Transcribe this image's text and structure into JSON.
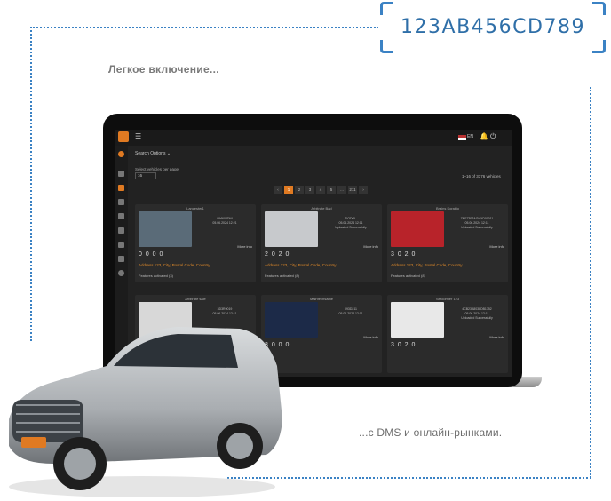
{
  "vin_code": "123AB456CD789",
  "caption_top": "Легкое включение...",
  "caption_bottom": "...с DMS и онлайн-рынками.",
  "colors": {
    "accent_blue": "#3b82c4",
    "accent_orange": "#e07a22"
  },
  "app": {
    "search_options": "Search Options ⌄",
    "select_label": "Select vehicles per page",
    "select_value": "16",
    "count_text": "1–16 of 3376 vehicles",
    "lang": "EN",
    "pagination": [
      "‹",
      "1",
      "2",
      "3",
      "4",
      "5",
      "...",
      "211",
      "›"
    ],
    "address": "Address 123, City, Postal Code, Country",
    "features": "Features activated (8)",
    "more_info": "More info",
    "cards": [
      {
        "title": "Lancester1",
        "meta1": "0WN02DW",
        "meta2": "05.06.2024 12:21",
        "status": "",
        "img": "#5a6b78",
        "icons": "0 0 0 0",
        "features": "Features activated (3)"
      },
      {
        "title": "Arbitrate Bad",
        "meta1": "DODOL",
        "meta2": "05.06.2024 12:11",
        "status": "Uploaded Successfully",
        "img": "#c7c9cc",
        "icons": "2 0 2 0",
        "features": "Features activated (8)"
      },
      {
        "title": "Brains Sorakio",
        "meta1": "ZNF73F3AGHXD00011",
        "meta2": "05.06.2024 12:11",
        "status": "Uploaded Successfully",
        "img": "#b8232a",
        "icons": "3 0 2 0",
        "features": "Features activated (8)"
      },
      {
        "title": "Arbitrate sale",
        "meta1": "3D3R9019",
        "meta2": "05.06.2024 12:11",
        "status": "",
        "img": "#d8d8d8",
        "icons": "",
        "features": ""
      },
      {
        "title": "Mainfechsame",
        "meta1": "093D211",
        "meta2": "05.06.2024 12:11",
        "status": "",
        "img": "#1c2a48",
        "icons": "3 0 0 0",
        "features": ""
      },
      {
        "title": "Seroomier 123",
        "meta1": "4CB23A8038DB1752",
        "meta2": "05.06.2024 12:11",
        "status": "Uploaded Successfully",
        "img": "#e8e8e8",
        "icons": "3 0 2 0",
        "features": ""
      }
    ]
  }
}
